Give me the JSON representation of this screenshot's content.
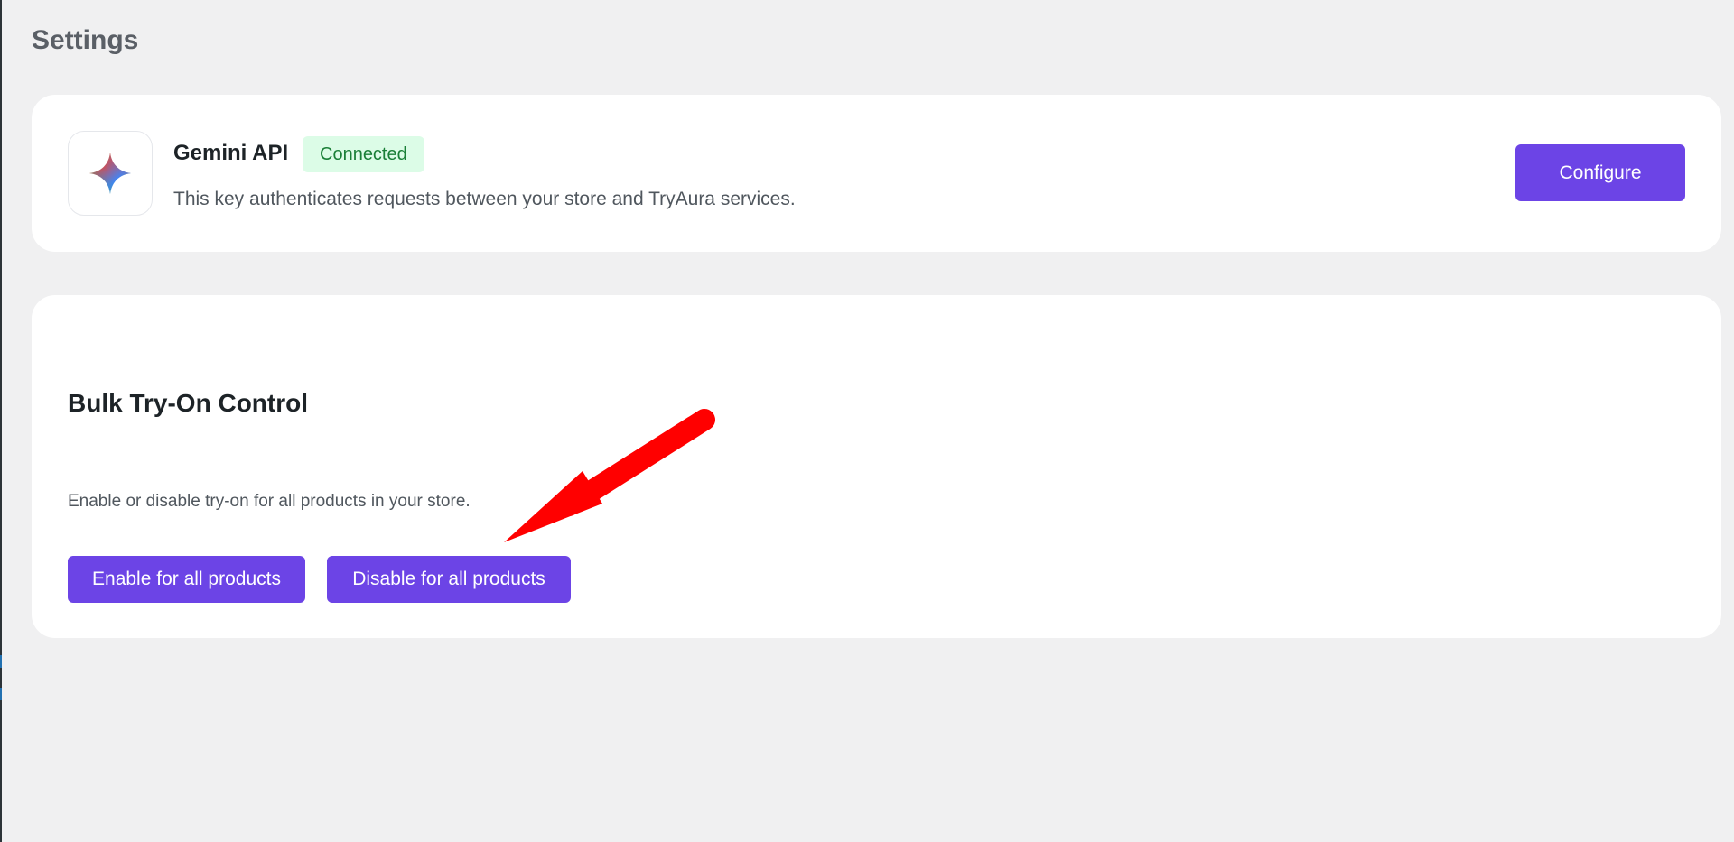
{
  "page": {
    "title": "Settings"
  },
  "api_card": {
    "icon": "gemini-sparkle-icon",
    "title": "Gemini API",
    "status": "Connected",
    "description": "This key authenticates requests between your store and TryAura services.",
    "configure_label": "Configure"
  },
  "bulk_card": {
    "title": "Bulk Try-On Control",
    "description": "Enable or disable try-on for all products in your store.",
    "enable_label": "Enable for all products",
    "disable_label": "Disable for all products"
  },
  "colors": {
    "accent": "#6c44e6",
    "status_text": "#1a7f37",
    "status_bg": "#dcfce7",
    "annotation_arrow": "#ff0000"
  }
}
